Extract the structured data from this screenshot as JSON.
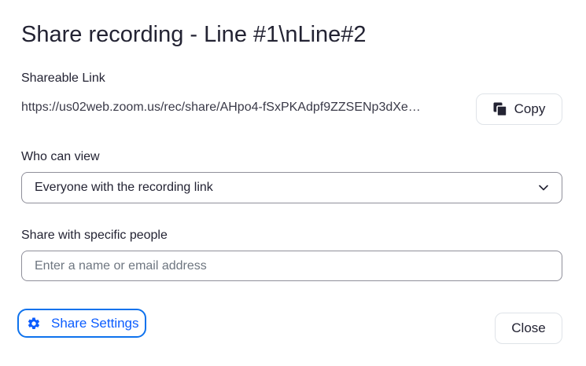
{
  "dialog": {
    "title": "Share recording - Line #1\\nLine#2"
  },
  "shareable_link": {
    "label": "Shareable Link",
    "url": "https://us02web.zoom.us/rec/share/AHpo4-fSxPKAdpf9ZZSENp3dXe…",
    "copy_label": "Copy",
    "copy_icon": "copy-icon"
  },
  "who_can_view": {
    "label": "Who can view",
    "selected": "Everyone with the recording link",
    "icon": "chevron-down-icon"
  },
  "specific_people": {
    "label": "Share with specific people",
    "placeholder": "Enter a name or email address",
    "value": ""
  },
  "footer": {
    "settings_label": "Share Settings",
    "settings_icon": "gear-icon",
    "close_label": "Close"
  },
  "colors": {
    "accent": "#0b5cff",
    "text": "#232333",
    "border": "#8f8f9a"
  }
}
